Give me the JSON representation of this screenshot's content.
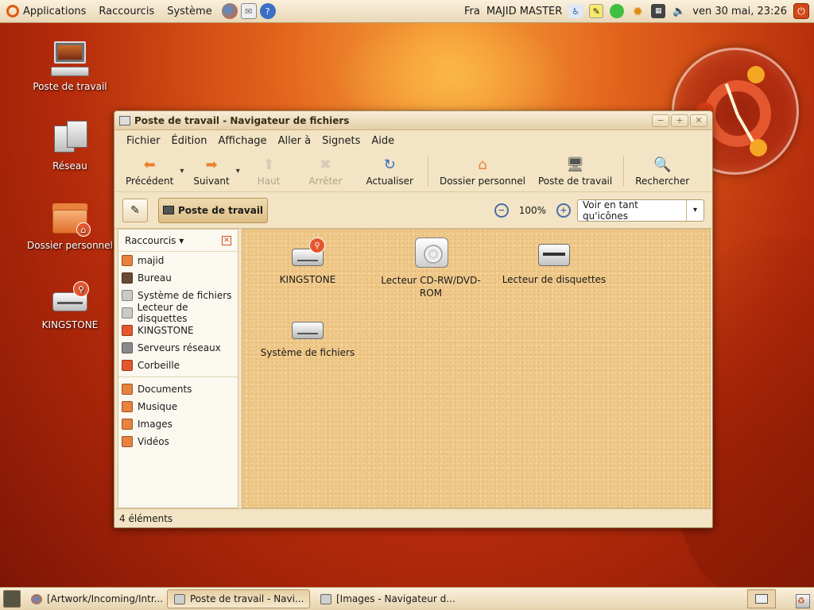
{
  "top_panel": {
    "menus": [
      "Applications",
      "Raccourcis",
      "Système"
    ],
    "launchers": [
      "firefox-icon",
      "mail-icon",
      "help-icon"
    ],
    "keyboard_layout": "Fra",
    "user": "MAJID MASTER",
    "datetime": "ven 30 mai, 23:26"
  },
  "desktop": {
    "icons": [
      {
        "label": "Poste de travail",
        "icon": "computer-icon"
      },
      {
        "label": "Réseau",
        "icon": "network-icon"
      },
      {
        "label": "Dossier personnel",
        "icon": "home-folder-icon"
      },
      {
        "label": "KINGSTONE",
        "icon": "usb-drive-icon"
      }
    ]
  },
  "window": {
    "title": "Poste de travail - Navigateur de fichiers",
    "menus": [
      "Fichier",
      "Édition",
      "Affichage",
      "Aller à",
      "Signets",
      "Aide"
    ],
    "toolbar": {
      "back": "Précédent",
      "forward": "Suivant",
      "up": "Haut",
      "stop": "Arrêter",
      "reload": "Actualiser",
      "home": "Dossier personnel",
      "computer": "Poste de travail",
      "search": "Rechercher"
    },
    "location": {
      "path_button": "Poste de travail",
      "zoom": "100%",
      "view_mode": "Voir en tant qu'icônes"
    },
    "sidebar": {
      "header": "Raccourcis",
      "places": [
        {
          "label": "majid",
          "color": "#e8823d"
        },
        {
          "label": "Bureau",
          "color": "#6b4a32"
        },
        {
          "label": "Système de fichiers",
          "color": "#c9c9c9"
        },
        {
          "label": "Lecteur de disquettes",
          "color": "#c9c9c9"
        },
        {
          "label": "KINGSTONE",
          "color": "#e4572e"
        },
        {
          "label": "Serveurs réseaux",
          "color": "#8a8a8a"
        },
        {
          "label": "Corbeille",
          "color": "#e4572e"
        }
      ],
      "bookmarks": [
        {
          "label": "Documents",
          "color": "#e8823d"
        },
        {
          "label": "Musique",
          "color": "#e8823d"
        },
        {
          "label": "Images",
          "color": "#e8823d"
        },
        {
          "label": "Vidéos",
          "color": "#e8823d"
        }
      ]
    },
    "items": [
      {
        "label": "KINGSTONE",
        "type": "usb-drive"
      },
      {
        "label": "Lecteur CD-RW/DVD-ROM",
        "type": "cdrom"
      },
      {
        "label": "Lecteur de disquettes",
        "type": "floppy"
      },
      {
        "label": "Système de fichiers",
        "type": "harddisk"
      }
    ],
    "status": "4 éléments"
  },
  "taskbar": {
    "tasks": [
      {
        "label": "[Artwork/Incoming/Intr...",
        "active": false,
        "icon_color": "#e8823d"
      },
      {
        "label": "Poste de travail - Navi...",
        "active": true,
        "icon_color": "#cfcfcf"
      },
      {
        "label": "[Images - Navigateur d...",
        "active": false,
        "icon_color": "#cfcfcf"
      }
    ]
  },
  "colors": {
    "accent": "#e4572e",
    "panel": "#f2e4c4"
  }
}
